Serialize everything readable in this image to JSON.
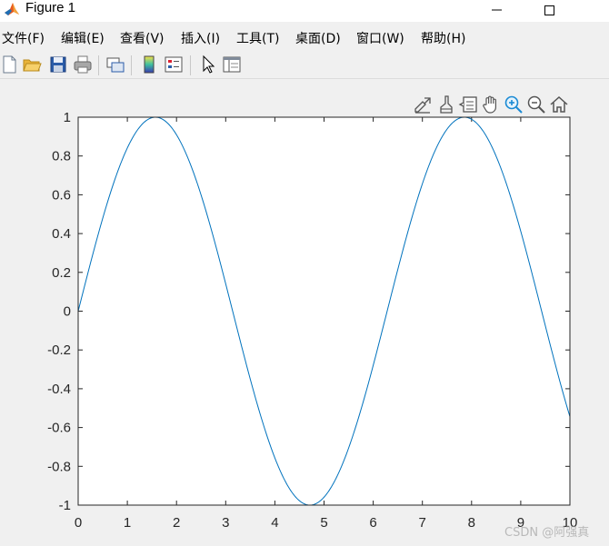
{
  "window": {
    "title": "Figure 1"
  },
  "menu": {
    "items": [
      "文件(F)",
      "编辑(E)",
      "查看(V)",
      "插入(I)",
      "工具(T)",
      "桌面(D)",
      "窗口(W)",
      "帮助(H)"
    ]
  },
  "toolbar": {
    "icons": [
      "new-figure-icon",
      "open-file-icon",
      "save-icon",
      "print-icon",
      "link-plot-icon",
      "insert-colorbar-icon",
      "insert-legend-icon",
      "edit-plot-icon",
      "property-inspector-icon"
    ]
  },
  "axes_toolbar": {
    "icons": [
      "export-icon",
      "brush-icon",
      "data-tips-icon",
      "pan-icon",
      "zoom-in-icon",
      "zoom-out-icon",
      "restore-view-icon"
    ]
  },
  "watermark": "CSDN @阿强真",
  "colors": {
    "line": "#0072bd",
    "axes_bg": "#ffffff",
    "figure_bg": "#f0f0f0"
  },
  "chart_data": {
    "type": "line",
    "function": "sin(x)",
    "x_range": [
      0,
      10
    ],
    "xlim": [
      0,
      10
    ],
    "ylim": [
      -1,
      1
    ],
    "x_ticks": [
      "0",
      "1",
      "2",
      "3",
      "4",
      "5",
      "6",
      "7",
      "8",
      "9",
      "10"
    ],
    "y_ticks": [
      "1",
      "0.8",
      "0.6",
      "0.4",
      "0.2",
      "0",
      "-0.2",
      "-0.4",
      "-0.6",
      "-0.8",
      "-1"
    ],
    "series": [
      {
        "x": [
          0,
          0.5,
          1,
          1.5,
          1.5708,
          2,
          2.5,
          3,
          3.5,
          4,
          4.5,
          4.7124,
          5,
          5.5,
          6,
          6.5,
          7,
          7.5,
          7.854,
          8,
          8.5,
          9,
          9.5,
          10
        ],
        "y": [
          0,
          0.479,
          0.841,
          0.997,
          1,
          0.909,
          0.598,
          0.141,
          -0.351,
          -0.757,
          -0.978,
          -1,
          -0.959,
          -0.706,
          -0.279,
          0.215,
          0.657,
          0.938,
          1,
          0.989,
          0.798,
          0.412,
          -0.075,
          -0.544
        ]
      }
    ],
    "grid": false,
    "box": true
  }
}
